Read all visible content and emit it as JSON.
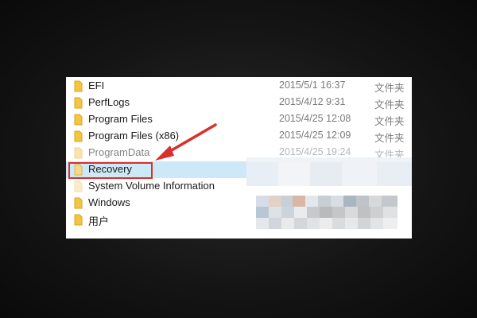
{
  "file_list": {
    "rows": [
      {
        "name": "EFI",
        "date": "2015/5/1 16:37",
        "type": "文件夹"
      },
      {
        "name": "PerfLogs",
        "date": "2015/4/12 9:31",
        "type": "文件夹"
      },
      {
        "name": "Program Files",
        "date": "2015/4/25 12:08",
        "type": "文件夹"
      },
      {
        "name": "Program Files (x86)",
        "date": "2015/4/25 12:09",
        "type": "文件夹"
      },
      {
        "name": "ProgramData",
        "date": "2015/4/25 19:24",
        "type": "文件夹"
      },
      {
        "name": "Recovery",
        "date": "",
        "type": ""
      },
      {
        "name": "System Volume Information",
        "date": "",
        "type": ""
      },
      {
        "name": "Windows",
        "date": "",
        "type": ""
      },
      {
        "name": "用户",
        "date": "",
        "type": ""
      }
    ]
  },
  "annotation": {
    "highlight_color": "#d8302c",
    "highlighted_item": "Recovery"
  },
  "colors": {
    "folder_yellow": "#f5c542",
    "selection_blue": "#cde8f7"
  }
}
